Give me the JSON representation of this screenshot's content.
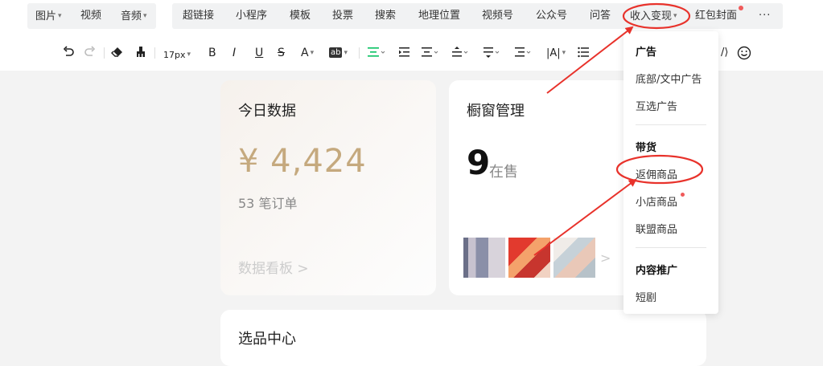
{
  "topbar": {
    "media_items": [
      {
        "label": "图片",
        "dropdown": true
      },
      {
        "label": "视频",
        "dropdown": false
      },
      {
        "label": "音频",
        "dropdown": true
      }
    ],
    "insert_items": [
      {
        "label": "超链接"
      },
      {
        "label": "小程序"
      },
      {
        "label": "模板"
      },
      {
        "label": "投票"
      },
      {
        "label": "搜索"
      },
      {
        "label": "地理位置"
      },
      {
        "label": "视频号"
      },
      {
        "label": "公众号"
      },
      {
        "label": "问答"
      },
      {
        "label": "收入变现",
        "dropdown": true,
        "highlighted": true
      },
      {
        "label": "红包封面",
        "badge_dot": true
      }
    ],
    "more_label": "···"
  },
  "format_toolbar": {
    "font_size": "17px",
    "bold": "B",
    "italic": "I",
    "underline": "U",
    "strikethrough": "S",
    "font_color": "A",
    "bg_color": "ab"
  },
  "cards": {
    "today": {
      "title": "今日数据",
      "amount": "¥ 4,424",
      "orders": "53 笔订单",
      "dashboard_link": "数据看板 >"
    },
    "showcase": {
      "title": "橱窗管理",
      "count": "9",
      "unit": "在售",
      "more_arrow": ">"
    },
    "selection": {
      "title": "选品中心"
    }
  },
  "dropdown": {
    "sections": [
      {
        "header": "广告",
        "items": [
          {
            "label": "底部/文中广告"
          },
          {
            "label": "互选广告"
          }
        ]
      },
      {
        "header": "带货",
        "items": [
          {
            "label": "返佣商品",
            "highlighted": true
          },
          {
            "label": "小店商品",
            "badge_dot": true
          },
          {
            "label": "联盟商品"
          }
        ]
      },
      {
        "header": "内容推广",
        "items": [
          {
            "label": "短剧"
          }
        ]
      }
    ]
  },
  "annotation_color": "#e8322b",
  "badge_color": "#f05a5a",
  "gold_color": "#c5a97e"
}
